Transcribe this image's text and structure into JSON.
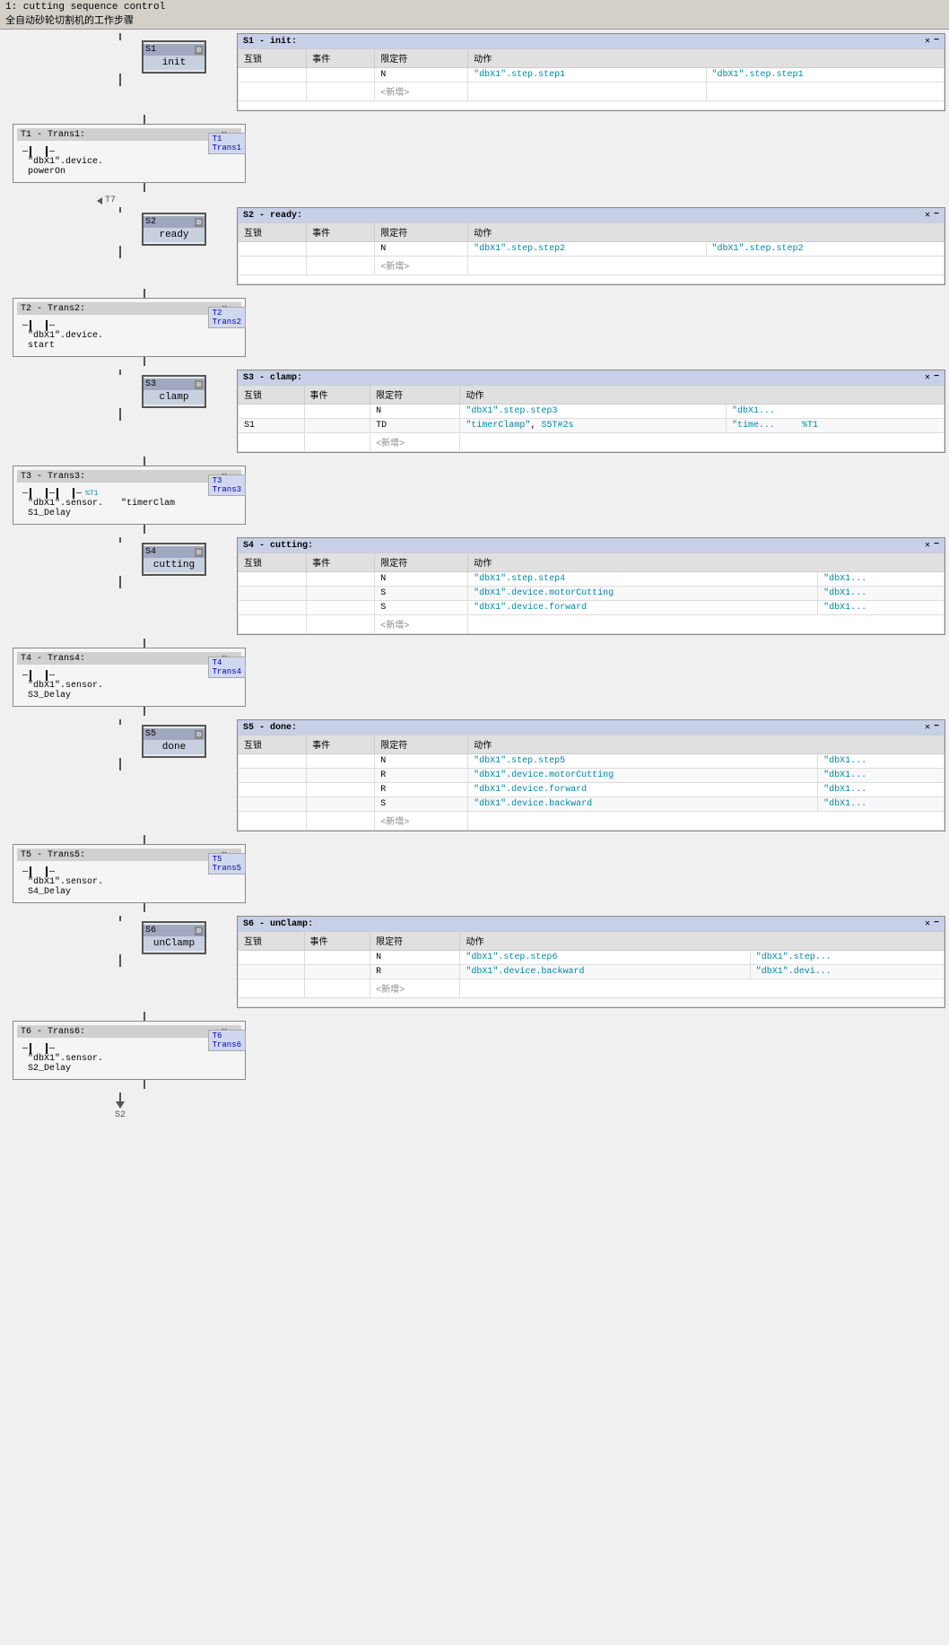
{
  "header": {
    "line1": "1: cutting sequence control",
    "line2": "全自动砂轮切割机的工作步骤"
  },
  "steps": [
    {
      "id": "S1",
      "name": "init",
      "table_title": "S1 - init:",
      "columns": [
        "互锁",
        "事件",
        "限定符",
        "动作"
      ],
      "rows": [
        {
          "interlock": "",
          "event": "",
          "qualifier": "N",
          "action1": "\"dbX1\".step.step1",
          "action2": "\"dbX1\".step.step1"
        },
        {
          "interlock": "",
          "event": "",
          "qualifier": "<新增>",
          "action1": "",
          "action2": ""
        }
      ]
    },
    {
      "id": "S2",
      "name": "ready",
      "table_title": "S2 - ready:",
      "columns": [
        "互锁",
        "事件",
        "限定符",
        "动作"
      ],
      "rows": [
        {
          "interlock": "",
          "event": "",
          "qualifier": "N",
          "action1": "\"dbX1\".step.step2",
          "action2": "\"dbX1\".step.step2"
        },
        {
          "interlock": "",
          "event": "",
          "qualifier": "<新增>",
          "action1": "",
          "action2": ""
        }
      ]
    },
    {
      "id": "S3",
      "name": "clamp",
      "table_title": "S3 - clamp:",
      "columns": [
        "互锁",
        "事件",
        "限定符",
        "动作"
      ],
      "rows": [
        {
          "interlock": "",
          "event": "",
          "qualifier": "N",
          "action1": "\"dbX1\".step.step3",
          "action2": "\"dbX1..."
        },
        {
          "interlock": "S1",
          "event": "",
          "qualifier": "TD",
          "action1": "\"timerClamp\", S5T#2s",
          "action2": "\"time...      %T1"
        },
        {
          "interlock": "",
          "event": "",
          "qualifier": "<新增>",
          "action1": "",
          "action2": ""
        }
      ]
    },
    {
      "id": "S4",
      "name": "cutting",
      "table_title": "S4 - cutting:",
      "columns": [
        "互锁",
        "事件",
        "限定符",
        "动作"
      ],
      "rows": [
        {
          "interlock": "",
          "event": "",
          "qualifier": "N",
          "action1": "\"dbX1\".step.step4",
          "action2": "\"dbX1..."
        },
        {
          "interlock": "",
          "event": "",
          "qualifier": "S",
          "action1": "\"dbX1\".device.motorCutting",
          "action2": "\"dbX1..."
        },
        {
          "interlock": "",
          "event": "",
          "qualifier": "S",
          "action1": "\"dbX1\".device.forward",
          "action2": "\"dbX1..."
        },
        {
          "interlock": "",
          "event": "",
          "qualifier": "<新增>",
          "action1": "",
          "action2": ""
        }
      ]
    },
    {
      "id": "S5",
      "name": "done",
      "table_title": "S5 - done:",
      "columns": [
        "互锁",
        "事件",
        "限定符",
        "动作"
      ],
      "rows": [
        {
          "interlock": "",
          "event": "",
          "qualifier": "N",
          "action1": "\"dbX1\".step.step5",
          "action2": "\"dbX1..."
        },
        {
          "interlock": "",
          "event": "",
          "qualifier": "R",
          "action1": "\"dbX1\".device.motorCutting",
          "action2": "\"dbX1..."
        },
        {
          "interlock": "",
          "event": "",
          "qualifier": "R",
          "action1": "\"dbX1\".device.forward",
          "action2": "\"dbX1..."
        },
        {
          "interlock": "",
          "event": "",
          "qualifier": "S",
          "action1": "\"dbX1\".device.backward",
          "action2": "\"dbX1..."
        },
        {
          "interlock": "",
          "event": "",
          "qualifier": "<新增>",
          "action1": "",
          "action2": ""
        }
      ]
    },
    {
      "id": "S6",
      "name": "unClamp",
      "table_title": "S6 - unClamp:",
      "columns": [
        "互锁",
        "事件",
        "限定符",
        "动作"
      ],
      "rows": [
        {
          "interlock": "",
          "event": "",
          "qualifier": "N",
          "action1": "\"dbX1\".step.step6",
          "action2": "\"dbX1\".step..."
        },
        {
          "interlock": "",
          "event": "",
          "qualifier": "R",
          "action1": "\"dbX1\".device.backward",
          "action2": "\"dbX1\".devi..."
        },
        {
          "interlock": "",
          "event": "",
          "qualifier": "<新增>",
          "action1": "",
          "action2": ""
        }
      ]
    }
  ],
  "transitions": [
    {
      "id": "T1",
      "name": "Trans1",
      "title": "T1 - Trans1:",
      "contact": "\"dbX1\".device.\npowerOn"
    },
    {
      "id": "T2",
      "name": "Trans2",
      "title": "T2 - Trans2:",
      "contact": "\"dbX1\".device.\nstart"
    },
    {
      "id": "T3",
      "name": "Trans3",
      "title": "T3 - Trans3:",
      "contact1": "\"dbX1\".sensor.\nS1_Delay",
      "contact2": "\"timerClam"
    },
    {
      "id": "T4",
      "name": "Trans4",
      "title": "T4 - Trans4:",
      "contact": "\"dbX1\".sensor.\nS3_Delay"
    },
    {
      "id": "T5",
      "name": "Trans5",
      "title": "T5 - Trans5:",
      "contact": "\"dbX1\".sensor.\nS4_Delay"
    },
    {
      "id": "T6",
      "name": "Trans6",
      "title": "T6 - Trans6:",
      "contact": "\"dbX1\".sensor.\nS2_Delay"
    }
  ],
  "back_arrow": {
    "label": "← T7",
    "dest": "S2"
  },
  "footer_arrow": "S2"
}
